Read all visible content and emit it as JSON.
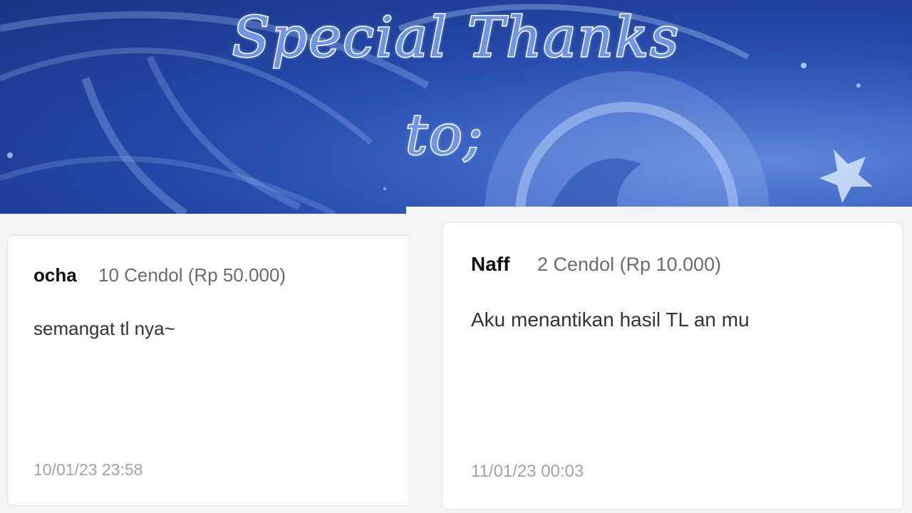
{
  "title": {
    "line1": "Special Thanks",
    "line2": "to;"
  },
  "colors": {
    "banner": "#2347a8",
    "title_fill": "#6f96e6",
    "panel": "#f4f4f5",
    "card": "#ffffff",
    "timestamp": "#a3a3a3"
  },
  "donations": [
    {
      "name": "ocha",
      "amount": "10 Cendol (Rp 50.000)",
      "message": "semangat tl nya~",
      "timestamp": "10/01/23 23:58"
    },
    {
      "name": "Naff",
      "amount": "2 Cendol (Rp 10.000)",
      "message": "Aku menantikan hasil TL an mu",
      "timestamp": "11/01/23 00:03"
    }
  ]
}
